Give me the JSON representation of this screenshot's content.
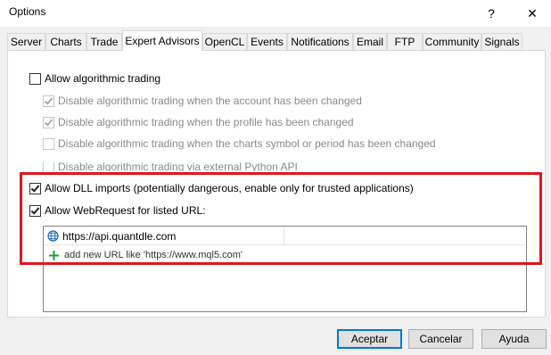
{
  "window": {
    "title": "Options",
    "help_glyph": "?",
    "close_glyph": "✕"
  },
  "tabs": [
    {
      "label": "Server"
    },
    {
      "label": "Charts"
    },
    {
      "label": "Trade"
    },
    {
      "label": "Expert Advisors",
      "active": true
    },
    {
      "label": "OpenCL"
    },
    {
      "label": "Events"
    },
    {
      "label": "Notifications"
    },
    {
      "label": "Email"
    },
    {
      "label": "FTP"
    },
    {
      "label": "Community"
    },
    {
      "label": "Signals"
    }
  ],
  "options": {
    "allow_algo": {
      "label": "Allow algorithmic trading",
      "checked": false,
      "enabled": true
    },
    "disable_account": {
      "label": "Disable algorithmic trading when the account has been changed",
      "checked": true,
      "enabled": false
    },
    "disable_profile": {
      "label": "Disable algorithmic trading when the profile has been changed",
      "checked": true,
      "enabled": false
    },
    "disable_symbol": {
      "label": "Disable algorithmic trading when the charts symbol or period has been changed",
      "checked": false,
      "enabled": false
    },
    "disable_python": {
      "label": "Disable algorithmic trading via external Python API",
      "checked": false,
      "enabled": false
    },
    "allow_dll": {
      "label": "Allow DLL imports (potentially dangerous, enable only for trusted applications)",
      "checked": true,
      "enabled": true
    },
    "allow_webrequest": {
      "label": "Allow WebRequest for listed URL:",
      "checked": true,
      "enabled": true
    }
  },
  "url_list": {
    "items": [
      {
        "url": "https://api.quantdle.com",
        "icon": "globe-icon"
      }
    ],
    "add_placeholder": "add new URL like 'https://www.mql5.com'",
    "add_icon": "plus-icon"
  },
  "colors": {
    "highlight": "#e0161d",
    "default_button_border": "#0078d7",
    "plus": "#1e9e3a"
  },
  "buttons": {
    "ok": "Aceptar",
    "cancel": "Cancelar",
    "help": "Ayuda"
  }
}
